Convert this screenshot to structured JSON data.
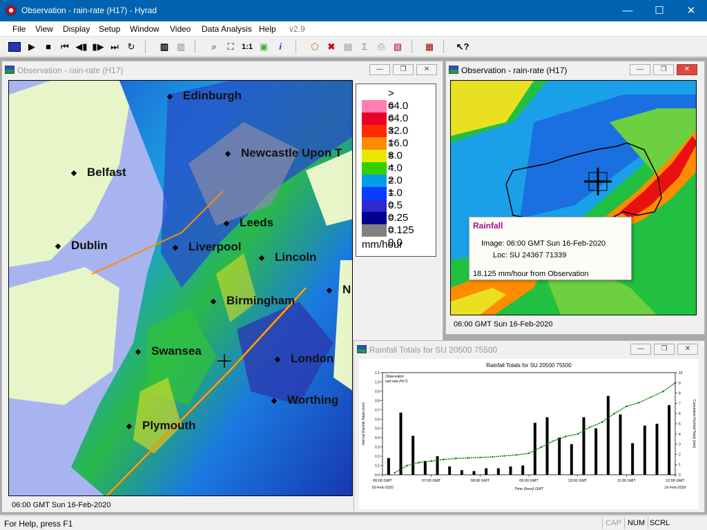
{
  "window": {
    "title": "Observation - rain-rate (H17) - Hyrad",
    "minimize": "—",
    "maximize": "☐",
    "close": "✕"
  },
  "menu": {
    "items": [
      "File",
      "View",
      "Display",
      "Setup",
      "Window",
      "Video",
      "Data Analysis",
      "Help"
    ],
    "version": "v2.9"
  },
  "toolbar": {
    "icons": [
      "radar-icon",
      "play-icon",
      "stop-icon",
      "skip-start-icon",
      "step-back-icon",
      "step-forward-icon",
      "skip-end-icon",
      "loop-icon",
      "all-layers-icon",
      "all-layers-off-icon",
      "zoom-icon",
      "crop-icon",
      "actual-size-icon",
      "overlay-icon",
      "info-icon",
      "catchment-icon",
      "delete-icon",
      "chart-icon",
      "sum-icon",
      "print-icon",
      "report-icon",
      "video-icon",
      "context-help-icon"
    ]
  },
  "uk_window": {
    "title": "Observation - rain-rate (H17)",
    "status": "06:00 GMT Sun 16-Feb-2020",
    "cities": [
      "Edinburgh",
      "Newcastle Upon T",
      "Belfast",
      "Leeds",
      "Dublin",
      "Liverpool",
      "Lincoln",
      "Birmingham",
      "N",
      "Swansea",
      "London",
      "Worthing",
      "Plymouth"
    ],
    "legend": {
      "unit": "mm/hour",
      "labels": [
        "> 64.0",
        "= 64.0",
        "= 32.0",
        "= 16.0",
        "= 8.0",
        "= 4.0",
        "= 2.0",
        "= 1.0",
        "= 0.5",
        "= 0.25",
        "= 0.125",
        "= 0.0"
      ],
      "colors": [
        "#ffffff",
        "#ff7fb4",
        "#e8002a",
        "#ff2a00",
        "#ff8c00",
        "#e8e800",
        "#32d000",
        "#009de8",
        "#0a3cff",
        "#2a2ad0",
        "#00008c",
        "#808080"
      ]
    }
  },
  "zoom_window": {
    "title": "Observation - rain-rate (H17)",
    "status": "06:00 GMT Sun 16-Feb-2020",
    "tooltip": {
      "title": "Rainfall",
      "image_line": "Image: 06:00 GMT Sun 16-Feb-2020",
      "loc_line": "Loc: SU 24367 71339",
      "value_line": "18.125 mm/hour from Observation"
    }
  },
  "chart_window": {
    "title": "Rainfall Totals for SU 20500 75500",
    "chart_title": "Rainfall Totals for SU 20500 75500"
  },
  "chart_data": {
    "type": "bar",
    "title": "Rainfall Totals for SU 20500 75500",
    "xlabel": "Time (hour) GMT",
    "ylabel": "Interval Rainfall Totals (mm)",
    "y2label": "Cumulative Rainfall Totals (mm)",
    "legend": [
      "Observation",
      "rain-rate (H17)"
    ],
    "x_ticks": [
      "06:00 GMT",
      "07:00 GMT",
      "08:00 GMT",
      "09:00 GMT",
      "10:00 GMT",
      "11:00 GMT",
      "12:00 GMT"
    ],
    "date_label": "16-Feb-2020",
    "ylim": [
      0,
      1.1
    ],
    "y2lim": [
      0,
      10
    ],
    "y_ticks": [
      0.0,
      0.1,
      0.2,
      0.3,
      0.4,
      0.5,
      0.6,
      0.7,
      0.8,
      0.9,
      1.0,
      1.1
    ],
    "y2_ticks": [
      0,
      1,
      2,
      3,
      4,
      5,
      6,
      7,
      8,
      9,
      10
    ],
    "interval_values": [
      0.18,
      0.67,
      0.42,
      0.15,
      0.2,
      0.09,
      0.05,
      0.04,
      0.07,
      0.07,
      0.09,
      0.1,
      0.56,
      0.62,
      0.4,
      0.33,
      0.62,
      0.5,
      0.85,
      0.65,
      0.34,
      0.53,
      0.55,
      0.75
    ],
    "cumulative_values": [
      0.2,
      0.9,
      1.2,
      1.35,
      1.5,
      1.6,
      1.65,
      1.7,
      1.75,
      1.85,
      1.95,
      2.1,
      2.7,
      3.3,
      3.75,
      4.0,
      4.65,
      5.15,
      6.0,
      6.7,
      7.05,
      7.6,
      8.15,
      9.0
    ]
  },
  "statusbar": {
    "help": "For Help, press F1",
    "indicators": [
      "CAP",
      "NUM",
      "SCRL"
    ]
  }
}
